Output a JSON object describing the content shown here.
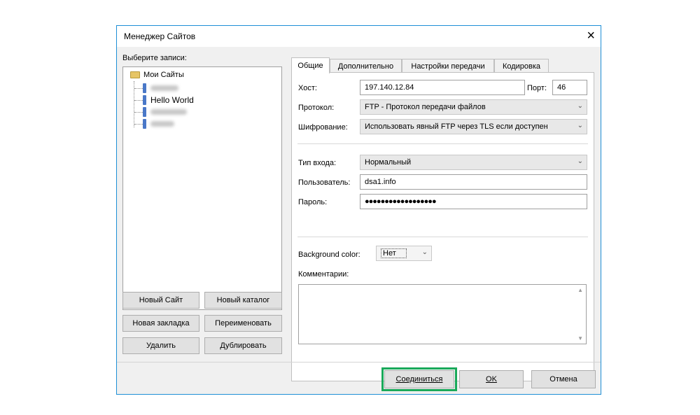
{
  "window": {
    "title": "Менеджер Сайтов",
    "close_glyph": "×"
  },
  "left": {
    "select_label": "Выберите записи:",
    "tree_root_label": "Мои Сайты",
    "tree_items": [
      "Hello World"
    ],
    "buttons": {
      "new_site": "Новый Сайт",
      "new_folder": "Новый каталог",
      "new_bookmark": "Новая закладка",
      "rename": "Переименовать",
      "delete": "Удалить",
      "duplicate": "Дублировать"
    }
  },
  "tabs": [
    "Общие",
    "Дополнительно",
    "Настройки передачи",
    "Кодировка"
  ],
  "general": {
    "host_label": "Хост:",
    "host_value": "197.140.12.84",
    "port_label": "Порт:",
    "port_value": "46",
    "protocol_label": "Протокол:",
    "protocol_value": "FTP - Протокол передачи файлов",
    "encryption_label": "Шифрование:",
    "encryption_value": "Использовать явный FTP через TLS если доступен",
    "login_type_label": "Тип входа:",
    "login_type_value": "Нормальный",
    "user_label": "Пользователь:",
    "user_value": "dsa1.info",
    "password_label": "Пароль:",
    "password_value": "●●●●●●●●●●●●●●●●●●",
    "bgcolor_label": "Background color:",
    "bgcolor_value": "Нет",
    "comments_label": "Комментарии:"
  },
  "footer": {
    "connect": "Соединиться",
    "ok": "OK",
    "cancel": "Отмена"
  },
  "colors": {
    "accent_border": "#1e8fd6",
    "highlight": "#1aa95a",
    "folder": "#e6c566",
    "server": "#4a78c8"
  },
  "icons": [
    "close-icon",
    "folder-icon",
    "server-icon",
    "chevron-down-icon",
    "scroll-up-icon",
    "scroll-down-icon"
  ]
}
